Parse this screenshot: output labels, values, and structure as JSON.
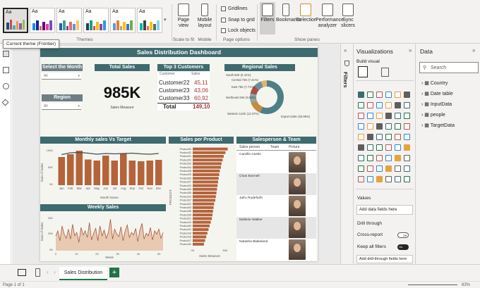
{
  "ribbon": {
    "themes_group": "Themes",
    "page_view": "Page view",
    "mobile_layout": "Mobile layout",
    "scale_group": "Scale to fit",
    "mobile_group": "Mobile",
    "gridlines": "Gridlines",
    "snap_to_grid": "Snap to grid",
    "lock_objects": "Lock objects",
    "page_options_group": "Page options",
    "filters": "Filters",
    "bookmarks": "Bookmarks",
    "selection": "Selection",
    "performance_analyzer": "Performance analyzer",
    "sync_slicers": "Sync slicers",
    "show_panes_group": "Show panes",
    "theme_letter": "Aa"
  },
  "tooltip": "Current theme (Frontier)",
  "report": {
    "title": "Sales Distribution Dashboard",
    "select_month": "Select the Month",
    "region": "Region",
    "all": "All",
    "total_sales_title": "Total Sales",
    "total_sales_value": "985K",
    "sales_measure": "Sales Measure",
    "top3_title": "Top 3 Customers",
    "top3_col_customer": "Customer",
    "top3_col_sales": "Sales",
    "top3_rows": [
      {
        "customer": "Customer22",
        "sales": "45,11"
      },
      {
        "customer": "Customer23",
        "sales": "43,06"
      },
      {
        "customer": "Customer33",
        "sales": "60,92"
      }
    ],
    "top3_total_label": "Total",
    "top3_total_value": "149,10",
    "regional_title": "Regional Sales",
    "regional_labels": [
      {
        "text": "South 53K (5.41%)"
      },
      {
        "text": "Central 73K (7.41%)"
      },
      {
        "text": "East 76K (7.71%)"
      },
      {
        "text": "Northeast 84K (8.53%)"
      },
      {
        "text": "Western 122K (12.37%)"
      },
      {
        "text": "Export 532K (53.99%)"
      }
    ],
    "monthly_title": "Monthly sales Vs Target",
    "monthly_ylabel": "Sum of Sales",
    "monthly_xlabel": "Month Name",
    "months": [
      "Jan",
      "Feb",
      "Mar",
      "Apr",
      "May",
      "Jun",
      "Jul",
      "Aug",
      "Sep",
      "Oct",
      "Nov",
      "Dec"
    ],
    "monthly_yticks": [
      "100K",
      "50K",
      "0K"
    ],
    "weekly_title": "Weekly Sales",
    "weekly_ylabel": "Sum of Sales",
    "weekly_xlabel": "Week",
    "weekly_yticks": [
      "40K",
      "20K",
      "0K"
    ],
    "weekly_xticks": [
      "0",
      "10",
      "20",
      "30",
      "40",
      "50"
    ],
    "product_title": "Sales per Product",
    "product_ylabel": "PRODUCT",
    "product_xlabel": "Sales Measure",
    "product_xticks": [
      "0K",
      "50K"
    ],
    "products": [
      "Product30",
      "Product32",
      "Product31",
      "Product29",
      "Product33",
      "Product34",
      "Product28",
      "Product25",
      "Product26",
      "Product27",
      "Product24",
      "Product35",
      "Product36",
      "Product23",
      "Product37",
      "Product22",
      "Product20",
      "Product38",
      "Product39",
      "Product21",
      "Product19",
      "Product40",
      "Product41",
      "Product18",
      "Product16",
      "Product17",
      "Product42"
    ],
    "team_title": "Salesperson & Team",
    "team_cols": [
      "Sales person",
      "Team",
      "Picture"
    ],
    "team_rows": [
      {
        "name": "Camille Castis"
      },
      {
        "name": "Chas Bonnell"
      },
      {
        "name": "Jafru Rudeforth"
      },
      {
        "name": "Mallorie Walker"
      },
      {
        "name": "Natasha Blakeland"
      }
    ]
  },
  "panes": {
    "filters": "Filters",
    "visualizations": "Visualizations",
    "build_visual": "Build visual",
    "values": "Values",
    "add_data_fields": "Add data fields here",
    "drill_through": "Drill through",
    "cross_report": "Cross-report",
    "cross_report_state": "Off",
    "keep_all_filters": "Keep all filters",
    "keep_all_filters_state": "On",
    "add_drill_fields": "Add drill-through fields here",
    "data": "Data",
    "search_placeholder": "Search",
    "tables": [
      "Country",
      "Date table",
      "InputData",
      "people",
      "TargetData"
    ]
  },
  "bottom": {
    "tab": "Sales Distribution",
    "status": "Page 1 of 1",
    "zoom": "63%"
  },
  "chart_data": [
    {
      "type": "bar",
      "categories": [
        "Jan",
        "Feb",
        "Mar",
        "Apr",
        "May",
        "Jun",
        "Jul",
        "Aug",
        "Sep",
        "Oct",
        "Nov",
        "Dec"
      ],
      "series": [
        {
          "values": [
            80,
            88,
            98,
            73,
            70,
            84,
            70,
            90,
            70,
            68,
            70,
            72
          ]
        },
        {
          "values": [
            87,
            92,
            93,
            91,
            88,
            90,
            89,
            90,
            91,
            89,
            88,
            90
          ]
        }
      ],
      "ylim": [
        0,
        100
      ]
    },
    {
      "type": "area",
      "x": [
        1,
        2,
        3,
        4,
        5,
        6,
        7,
        8,
        9,
        10,
        11,
        12,
        13,
        14,
        15,
        16,
        17,
        18,
        19,
        20,
        21,
        22,
        23,
        24,
        25,
        26,
        27,
        28,
        29,
        30,
        31,
        32,
        33,
        34,
        35,
        36,
        37,
        38,
        39,
        40,
        41,
        42,
        43,
        44,
        45,
        46,
        47,
        48,
        49,
        50,
        51,
        52
      ],
      "values": [
        18,
        24,
        12,
        30,
        20,
        15,
        26,
        14,
        32,
        18,
        22,
        10,
        28,
        19,
        24,
        16,
        34,
        13,
        21,
        27,
        12,
        30,
        18,
        25,
        15,
        22,
        38,
        14,
        26,
        20,
        17,
        29,
        12,
        24,
        31,
        16,
        22,
        19,
        27,
        11,
        25,
        33,
        14,
        21,
        18,
        28,
        13,
        24,
        20,
        26,
        15,
        22
      ],
      "ylim": [
        0,
        40
      ]
    },
    {
      "type": "bar",
      "categories": [
        "Product30",
        "Product32",
        "Product31",
        "Product29",
        "Product33",
        "Product34",
        "Product28",
        "Product25",
        "Product26",
        "Product27",
        "Product24",
        "Product35",
        "Product36",
        "Product23",
        "Product37",
        "Product22",
        "Product20",
        "Product38",
        "Product39",
        "Product21",
        "Product19",
        "Product40",
        "Product41",
        "Product18",
        "Product16",
        "Product17",
        "Product42"
      ],
      "values": [
        62,
        58,
        55,
        53,
        51,
        50,
        48,
        47,
        46,
        45,
        44,
        43,
        42,
        41,
        40,
        38,
        37,
        36,
        35,
        34,
        32,
        30,
        28,
        26,
        24,
        22,
        20
      ],
      "ylim": [
        0,
        70
      ]
    },
    {
      "type": "pie",
      "categories": [
        "Export",
        "Western",
        "Northeast",
        "East",
        "Central",
        "South"
      ],
      "values": [
        532,
        122,
        84,
        76,
        73,
        53
      ]
    }
  ],
  "colors": {
    "accent": "#3e6b6f",
    "bar": "#b5633a",
    "canvas": "#f5f5f0"
  }
}
